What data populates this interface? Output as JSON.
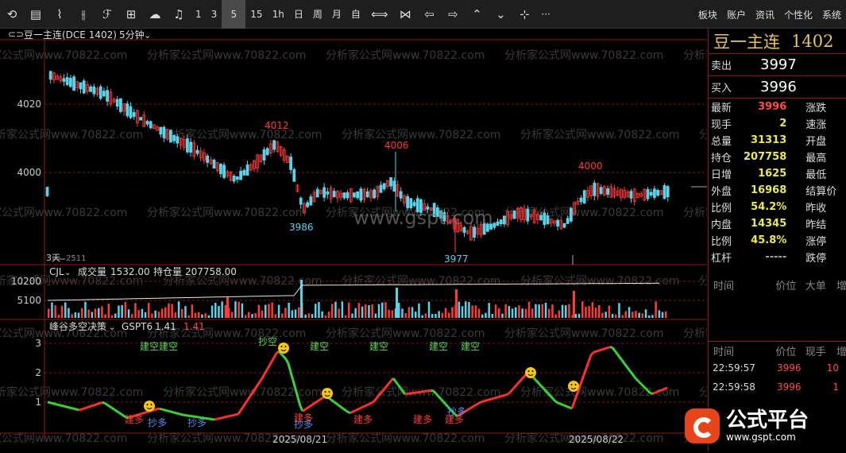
{
  "toolbar": {
    "items": [
      "1",
      "3",
      "5",
      "15",
      "1h",
      "日",
      "周",
      "月",
      "自"
    ],
    "more": "···",
    "right": [
      "板块",
      "账户",
      "资讯",
      "个性化",
      "系统"
    ]
  },
  "chart": {
    "title": "豆一主连(DCE 1402)",
    "period": "5分钟",
    "y_labels": [
      "4020",
      "4000"
    ],
    "annotations": {
      "high1": "4012",
      "high2": "4006",
      "high3": "4000",
      "low1": "3986",
      "low2": "3977"
    },
    "corner_label": "3天",
    "corner_value": "2511",
    "watermark": "www.gspt.com",
    "bg_watermark": "分析家公式网www.70822.com",
    "dates": [
      "2025/08/21",
      "2025/08/22"
    ]
  },
  "volume": {
    "label": "CJL",
    "vol_label": "成交量",
    "vol_value": "1532.00",
    "oi_label": "持仓量",
    "oi_value": "207758.00",
    "y_labels": [
      "10200",
      "5100"
    ]
  },
  "indicator": {
    "name": "峰谷多空决策",
    "sub": "GSPT6",
    "v1": "1.41",
    "v2": "1.41",
    "y_labels": [
      "3",
      "2",
      "1"
    ],
    "labels_top": [
      "建空建空",
      "抄空",
      "建空",
      "建空",
      "建空",
      "建空"
    ],
    "labels_bottom": [
      "建多",
      "抄多",
      "抄多",
      "建多",
      "抄多",
      "建多",
      "建多",
      "建多",
      "抄多"
    ]
  },
  "panel": {
    "title": "豆一主连",
    "code": "1402",
    "sell_label": "卖出",
    "sell": "3997",
    "buy_label": "买入",
    "buy": "3996",
    "rows": [
      {
        "l": "最新",
        "v": "3996",
        "c": "#ff4a4a",
        "r": "涨跌"
      },
      {
        "l": "现手",
        "v": "2",
        "c": "#e8e85a",
        "r": "速涨"
      },
      {
        "l": "总量",
        "v": "31313",
        "c": "#e8e85a",
        "r": "开盘"
      },
      {
        "l": "持仓",
        "v": "207758",
        "c": "#e8e85a",
        "r": "最高"
      },
      {
        "l": "日增",
        "v": "1625",
        "c": "#e8e85a",
        "r": "最低"
      },
      {
        "l": "外盘",
        "v": "16968",
        "c": "#e8e85a",
        "r": "结算价"
      },
      {
        "l": "比例",
        "v": "54.2%",
        "c": "#e8e85a",
        "r": "昨收"
      },
      {
        "l": "内盘",
        "v": "14345",
        "c": "#e8e85a",
        "r": "昨结"
      },
      {
        "l": "比例",
        "v": "45.8%",
        "c": "#e8e85a",
        "r": "涨停"
      },
      {
        "l": "杠杆",
        "v": "-----",
        "c": "#aaa",
        "r": "跌停"
      }
    ],
    "sec1": {
      "time": "时间",
      "price": "价位",
      "big": "大单",
      "more": "增"
    },
    "sec2": {
      "time": "时间",
      "price": "价位",
      "hand": "现手",
      "more": "增"
    },
    "ticks": [
      {
        "t": "22:59:57",
        "p": "3996",
        "h": "10"
      },
      {
        "t": "22:59:58",
        "p": "3996",
        "h": "1"
      }
    ]
  },
  "logo": {
    "text": "公式平台",
    "url": "www.gspt.com"
  }
}
